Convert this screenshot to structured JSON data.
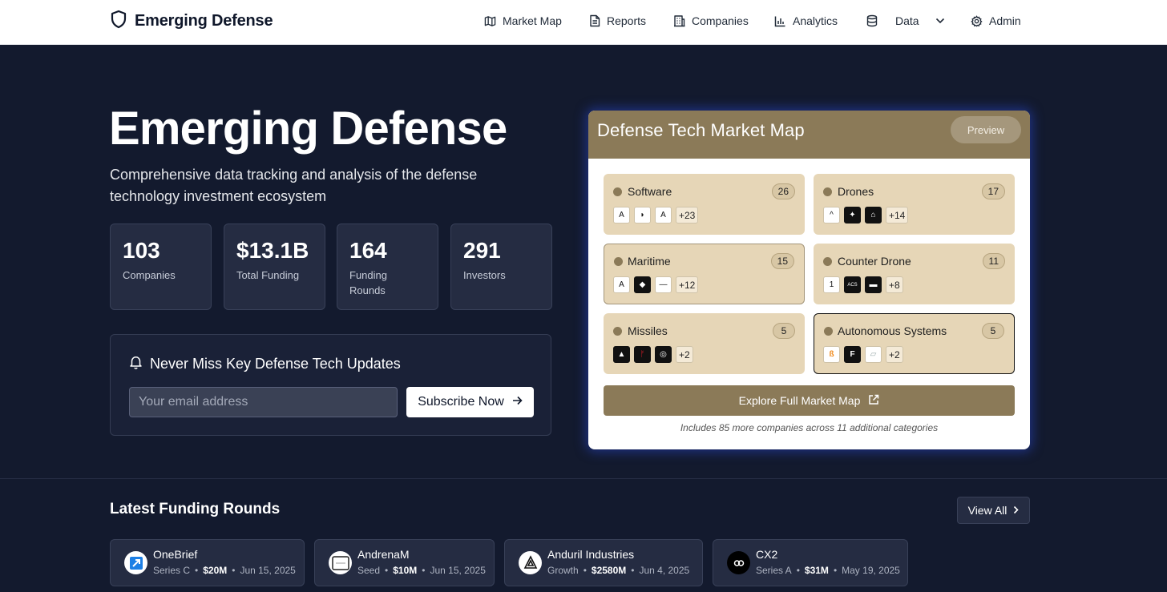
{
  "nav": {
    "brand": "Emerging Defense",
    "items": [
      {
        "label": "Market Map",
        "icon": "map-icon"
      },
      {
        "label": "Reports",
        "icon": "file-text-icon"
      },
      {
        "label": "Companies",
        "icon": "building-icon"
      },
      {
        "label": "Analytics",
        "icon": "bar-chart-icon"
      },
      {
        "label": "Data",
        "icon": "database-icon"
      },
      {
        "label": "Admin",
        "icon": "gear-icon"
      }
    ]
  },
  "hero": {
    "title": "Emerging Defense",
    "subtitle": "Comprehensive data tracking and analysis of the defense technology investment ecosystem",
    "stats": [
      {
        "value": "103",
        "label": "Companies"
      },
      {
        "value": "$13.1B",
        "label": "Total Funding"
      },
      {
        "value": "164",
        "label": "Funding Rounds"
      },
      {
        "value": "291",
        "label": "Investors"
      }
    ]
  },
  "newsletter": {
    "title": "Never Miss Key Defense Tech Updates",
    "placeholder": "Your email address",
    "button": "Subscribe Now"
  },
  "market_map": {
    "title": "Defense Tech Market Map",
    "preview_label": "Preview",
    "categories": [
      {
        "name": "Software",
        "count": "26",
        "logos": [
          "A",
          "◗",
          "A"
        ],
        "more": "+23"
      },
      {
        "name": "Drones",
        "count": "17",
        "logos": [
          "^",
          "✦",
          "⌂"
        ],
        "more": "+14"
      },
      {
        "name": "Maritime",
        "count": "15",
        "logos": [
          "A",
          "◆",
          "—"
        ],
        "more": "+12"
      },
      {
        "name": "Counter Drone",
        "count": "11",
        "logos": [
          "1",
          "ACS",
          "▬"
        ],
        "more": "+8"
      },
      {
        "name": "Missiles",
        "count": "5",
        "logos": [
          "▲",
          "ᚠ",
          "◎"
        ],
        "more": "+2"
      },
      {
        "name": "Autonomous Systems",
        "count": "5",
        "logos": [
          "ß",
          "F",
          "▱"
        ],
        "more": "+2"
      }
    ],
    "explore_label": "Explore Full Market Map",
    "note": "Includes 85 more companies across 11 additional categories"
  },
  "funding": {
    "title": "Latest Funding Rounds",
    "view_all": "View All",
    "rounds": [
      {
        "company": "OneBrief",
        "stage": "Series C",
        "amount": "$20M",
        "date": "Jun 15, 2025"
      },
      {
        "company": "AndrenaM",
        "stage": "Seed",
        "amount": "$10M",
        "date": "Jun 15, 2025"
      },
      {
        "company": "Anduril Industries",
        "stage": "Growth",
        "amount": "$2580M",
        "date": "Jun 4, 2025"
      },
      {
        "company": "CX2",
        "stage": "Series A",
        "amount": "$31M",
        "date": "May 19, 2025"
      }
    ]
  },
  "colors": {
    "background": "#131a2e",
    "map_accent": "#8b7a58",
    "category_bg": "#e6d6b7"
  }
}
